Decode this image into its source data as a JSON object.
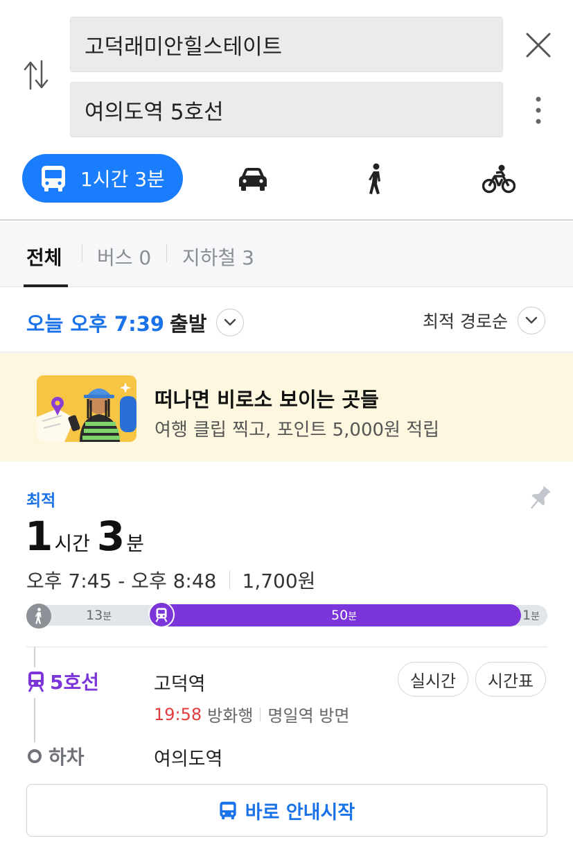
{
  "search": {
    "origin": "고덕래미안힐스테이트",
    "destination": "여의도역 5호선",
    "swap_icon": "swap-arrows-icon",
    "close_icon": "close-icon",
    "more_icon": "more-vertical-icon"
  },
  "modes": {
    "transit_duration": "1시간 3분",
    "items": [
      "bus-icon",
      "car-icon",
      "walk-icon",
      "bike-icon"
    ],
    "accent_color": "#1a7dfc"
  },
  "tabs": [
    {
      "label": "전체",
      "active": true
    },
    {
      "label": "버스 0",
      "active": false
    },
    {
      "label": "지하철 3",
      "active": false
    }
  ],
  "departure": {
    "time_label": "오늘 오후 7:39",
    "suffix": "출발",
    "sort_label": "최적 경로순"
  },
  "banner": {
    "title": "떠나면 비로소 보이는 곳들",
    "subtitle": "여행 클립 찍고, 포인트 5,000원 적립"
  },
  "route": {
    "badge": "최적",
    "hours": "1",
    "hours_unit": "시간",
    "minutes": "3",
    "minutes_unit": "분",
    "time_range": "오후 7:45 - 오후 8:48",
    "fare": "1,700원",
    "segments": {
      "walk_minutes": "13",
      "subway_minutes": "50",
      "end_walk_minutes": "1",
      "minute_unit": "분",
      "subway_color": "#7b35d8"
    },
    "line_name": "5호선",
    "board_station": "고덕역",
    "realtime_label": "실시간",
    "timetable_label": "시간표",
    "arrival_time": "19:58",
    "direction": "방화행",
    "platform_side": "명일역 방면",
    "alight_label": "하차",
    "alight_station": "여의도역",
    "start_button": "바로 안내시작"
  }
}
